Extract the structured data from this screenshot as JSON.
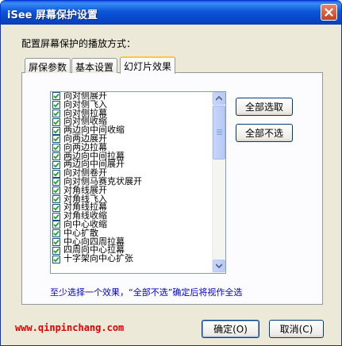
{
  "window": {
    "title": "iSee 屏幕保护设置",
    "close_glyph": "×"
  },
  "config_label": "配置屏幕保护的播放方式：",
  "tabs": [
    {
      "label": "屏保参数",
      "active": false
    },
    {
      "label": "基本设置",
      "active": false
    },
    {
      "label": "幻灯片效果",
      "active": true
    }
  ],
  "effects": {
    "items": [
      {
        "label": "向对侧展开",
        "checked": true
      },
      {
        "label": "向对侧飞入",
        "checked": true
      },
      {
        "label": "向对侧拉幕",
        "checked": true
      },
      {
        "label": "向对侧收缩",
        "checked": true
      },
      {
        "label": "两边向中间收缩",
        "checked": true
      },
      {
        "label": "向两边展开",
        "checked": true
      },
      {
        "label": "向两边拉幕",
        "checked": true
      },
      {
        "label": "两边向中间拉幕",
        "checked": true
      },
      {
        "label": "两边向中间展开",
        "checked": true
      },
      {
        "label": "向对侧卷开",
        "checked": true
      },
      {
        "label": "向对侧马赛克状展开",
        "checked": true
      },
      {
        "label": "对角线展开",
        "checked": true
      },
      {
        "label": "对角线飞入",
        "checked": true
      },
      {
        "label": "对角线拉幕",
        "checked": true
      },
      {
        "label": "对角线收缩",
        "checked": true
      },
      {
        "label": "向中心收缩",
        "checked": true
      },
      {
        "label": "中心扩散",
        "checked": true
      },
      {
        "label": "中心向四周拉幕",
        "checked": true
      },
      {
        "label": "四周向中心拉幕",
        "checked": true
      },
      {
        "label": "十字架向中心扩张",
        "checked": true
      }
    ]
  },
  "buttons": {
    "select_all": "全部选取",
    "deselect_all": "全部不选",
    "ok": "确定(O)",
    "cancel": "取消(C)"
  },
  "hint": "至少选择一个效果，“全部不选”确定后将视作全选",
  "watermark": "www.qinpinchang.com",
  "colors": {
    "titlebar": "#0b56d8",
    "dialog_bg": "#ece9d8",
    "hint_text": "#0000c8",
    "watermark_text": "#e00000",
    "active_tab_accent": "#ffc73c"
  },
  "icons": {
    "close": "close-icon",
    "check": "check-icon",
    "scroll_up": "arrow-up-icon",
    "scroll_down": "arrow-down-icon"
  }
}
